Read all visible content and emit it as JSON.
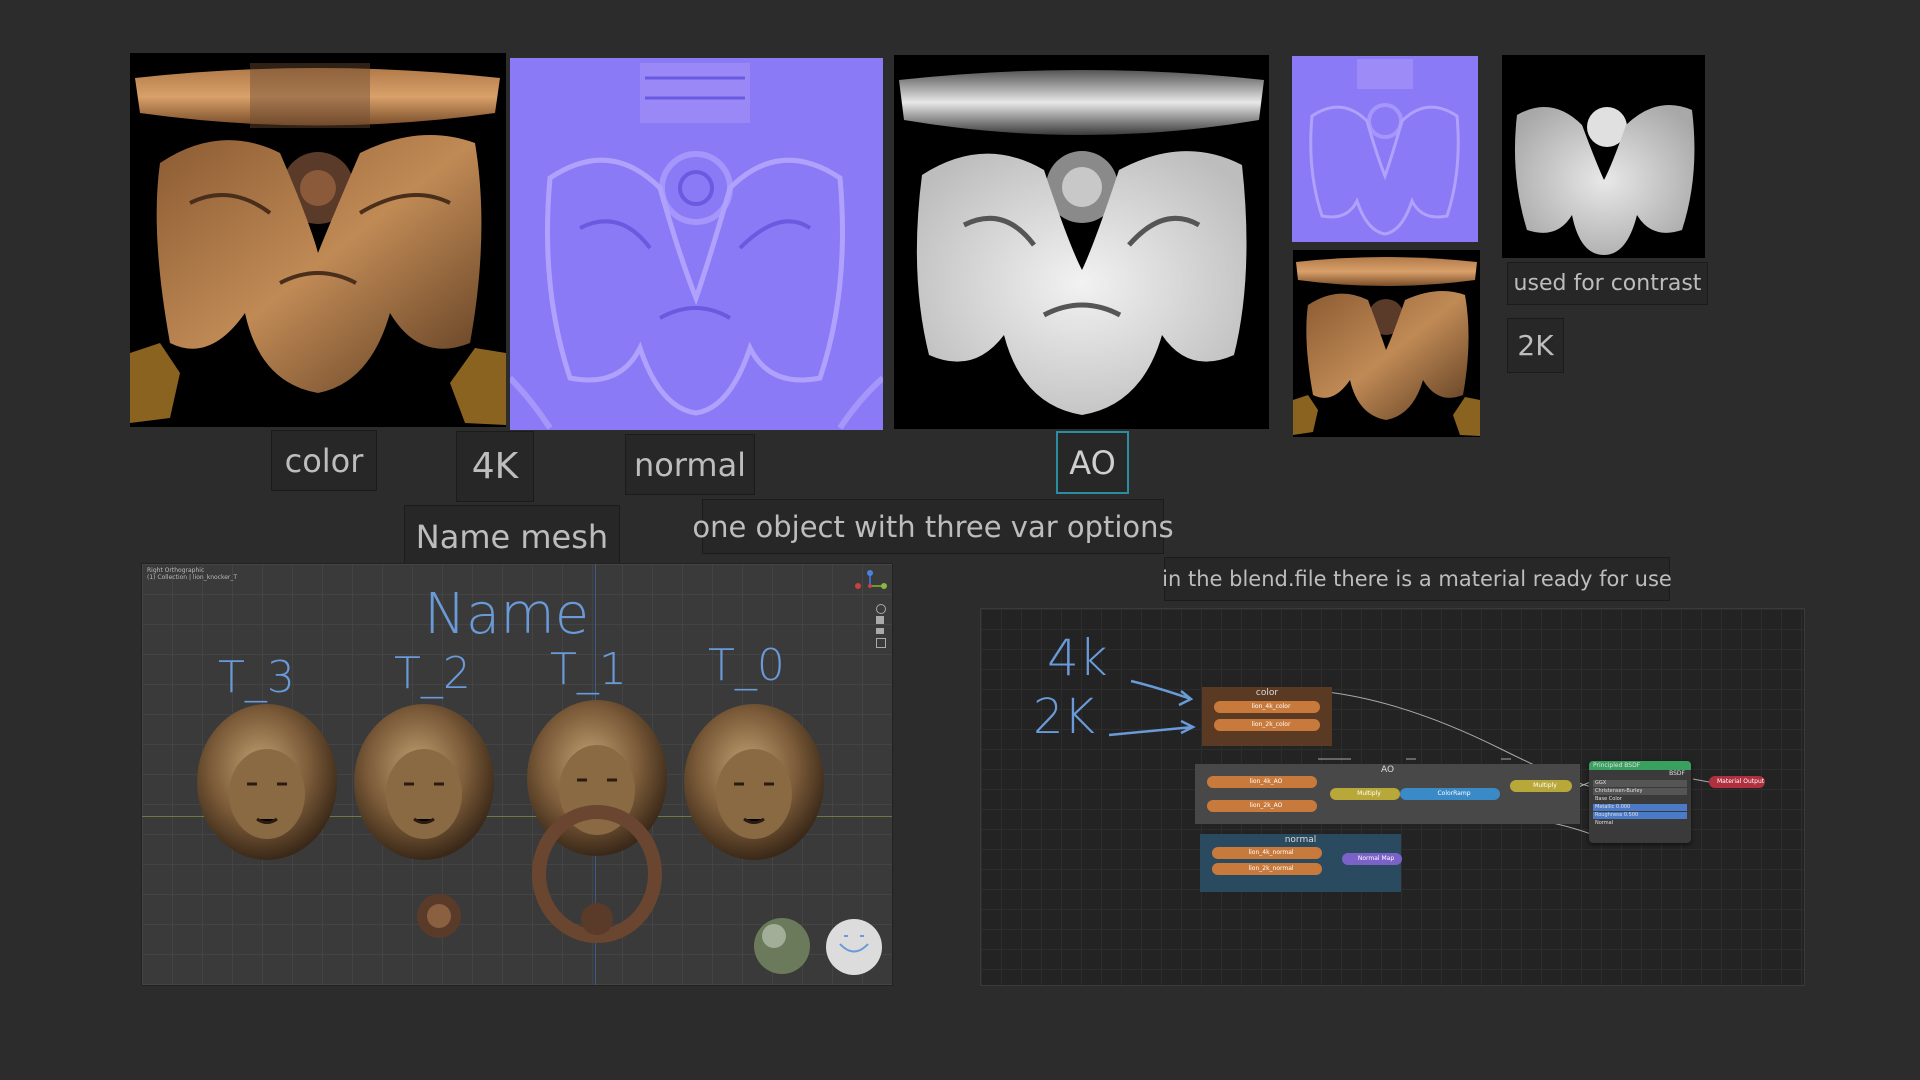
{
  "labels": {
    "color": "color",
    "resolution_4k": "4K",
    "normal": "normal",
    "ao": "AO",
    "used_for_contrast": "used for contrast",
    "resolution_2k": "2K",
    "name_mesh": "Name mesh",
    "one_object": "one object with three var options",
    "blend_note": "in the blend.file there is a material ready for use"
  },
  "viewport": {
    "handwritten_title": "Name",
    "variants": [
      "T_3",
      "T_2",
      "T_1",
      "T_0"
    ],
    "corner_header_lines": [
      "Right Orthographic",
      "(1) Collection | lion_knocker_T"
    ]
  },
  "node_editor": {
    "handwritten_4k": "4k",
    "handwritten_2k": "2K",
    "frames": {
      "color": "color",
      "ao": "AO",
      "normal": "normal"
    },
    "nodes": {
      "color_tex_1": "lion_4k_color",
      "color_tex_2": "lion_2k_color",
      "ao_tex_1": "lion_4k_AO",
      "ao_tex_2": "lion_2k_AO",
      "mix": "Multiply",
      "ramp": "ColorRamp",
      "mix2": "Multiply",
      "normal_tex_1": "lion_4k_normal",
      "normal_tex_2": "lion_2k_normal",
      "normal_map": "Normal Map",
      "bsdf_title": "Principled BSDF",
      "bsdf_out": "BSDF",
      "bsdf_rows": [
        "GGX",
        "Christensen-Burley",
        "Base Color",
        "Metallic 0.000",
        "Roughness 0.500",
        "Normal"
      ],
      "output": "Material Output"
    }
  },
  "colors": {
    "background": "#2c2c2c",
    "normal_map_purple": "#8a7af5",
    "node_orange": "#c87a3c",
    "node_yellow": "#b8a83a",
    "node_blue": "#3a8ac8",
    "node_purple": "#7a62c8",
    "bsdf_green": "#3aa060",
    "output_red": "#b03040",
    "ao_border": "#2a8ea0",
    "handwriting_blue": "#6a9ad8"
  }
}
